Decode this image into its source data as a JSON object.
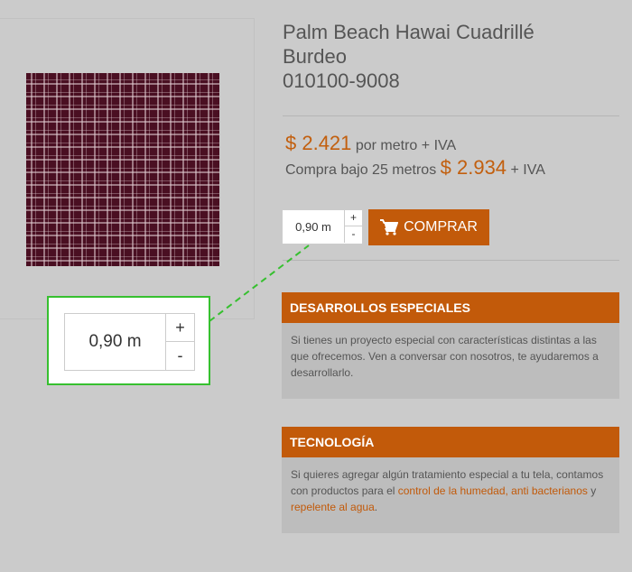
{
  "product": {
    "title_line1": "Palm Beach Hawai Cuadrillé",
    "title_line2": "Burdeo",
    "sku": "010100-9008",
    "image_icon": "plaid-fabric-swatch"
  },
  "pricing": {
    "price_main": "$ 2.421",
    "price_main_suffix": "por metro + IVA",
    "price_alt_prefix": "Compra bajo 25 metros",
    "price_alt": "$ 2.934",
    "price_alt_suffix": "+ IVA"
  },
  "purchase": {
    "quantity_value": "0,90 m",
    "plus_label": "+",
    "minus_label": "-",
    "buy_label": "COMPRAR",
    "buy_icon": "cart-icon"
  },
  "panels": {
    "special": {
      "title": "DESARROLLOS ESPECIALES",
      "body": "Si tienes un proyecto especial con características distintas a las que ofrecemos. Ven a conversar con nosotros, te ayudaremos a desarrollarlo."
    },
    "tech": {
      "title": "TECNOLOGÍA",
      "body_start": "Si quieres agregar algún tratamiento especial a tu tela, contamos con productos para el ",
      "link1": "control de la humedad, anti bacterianos",
      "body_mid": " y ",
      "link2": "repelente al agua",
      "body_end": "."
    }
  },
  "zoom_callout": {
    "quantity_value": "0,90 m",
    "plus_label": "+",
    "minus_label": "-"
  },
  "colors": {
    "accent": "#c25a0a",
    "price": "#c25f0e",
    "highlight": "#36c02f",
    "background": "#cbcbcb"
  }
}
